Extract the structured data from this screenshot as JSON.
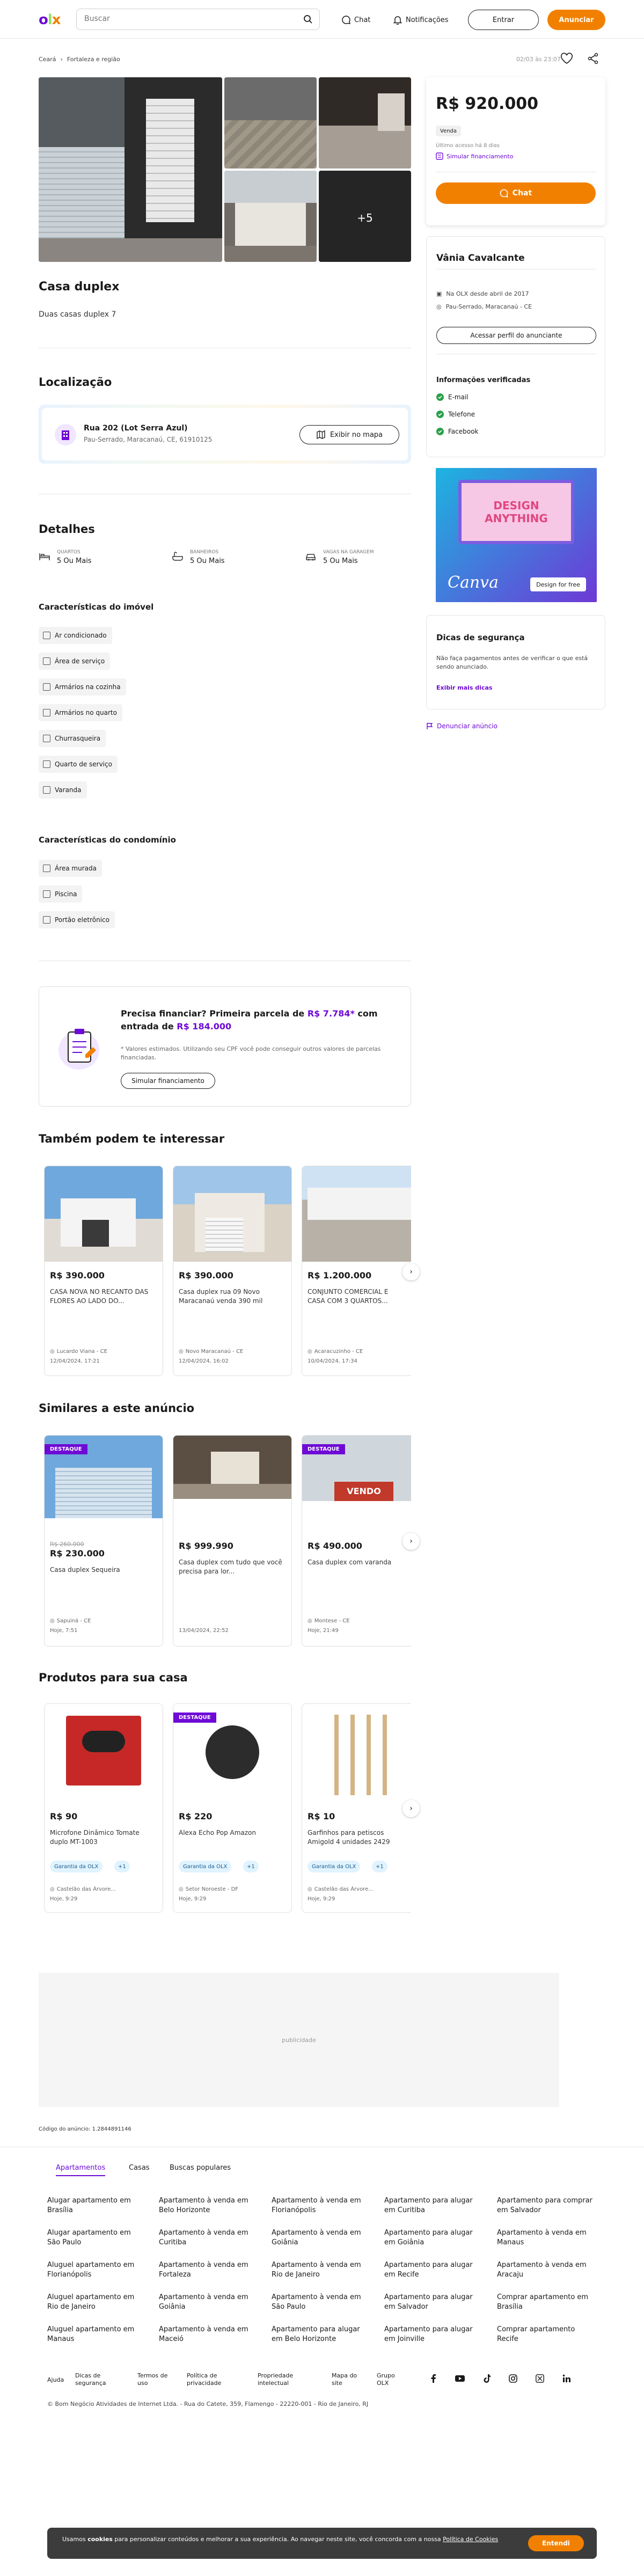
{
  "header": {
    "logo": {
      "o": "o",
      "l": "l",
      "x": "x"
    },
    "search_placeholder": "Buscar",
    "chat_label": "Chat",
    "notifications_label": "Notificações",
    "login_label": "Entrar",
    "advertise_label": "Anunciar"
  },
  "breadcrumb": {
    "items": [
      "Ceará",
      "Fortaleza e região"
    ],
    "date": "02/03 às 23:07"
  },
  "gallery": {
    "more_label": "+5"
  },
  "listing": {
    "title": "Casa duplex",
    "description": "Duas casas duplex 7",
    "location_heading": "Localização",
    "address_line1": "Rua 202 (Lot Serra Azul)",
    "address_line2": "Pau-Serrado, Maracanaú, CE, 61910125",
    "show_map_label": "Exibir no mapa",
    "details_heading": "Detalhes",
    "details": [
      {
        "label": "QUARTOS",
        "value": "5 Ou Mais"
      },
      {
        "label": "BANHEIROS",
        "value": "5 Ou Mais"
      },
      {
        "label": "VAGAS NA GARAGEM",
        "value": "5 Ou Mais"
      }
    ],
    "features_heading": "Características do imóvel",
    "features": [
      "Ar condicionado",
      "Área de serviço",
      "Armários na cozinha",
      "Armários no quarto",
      "Churrasqueira",
      "Quarto de serviço",
      "Varanda"
    ],
    "condo_heading": "Características do condomínio",
    "condo_features": [
      "Área murada",
      "Piscina",
      "Portão eletrônico"
    ]
  },
  "financing": {
    "title_prefix": "Precisa financiar? Primeira parcela de ",
    "first_installment": "R$ 7.784*",
    "title_mid": " com entrada de ",
    "down_payment": "R$ 184.000",
    "note": "* Valores estimados. Utilizando seu CPF você pode conseguir outros valores de parcelas financiadas.",
    "button": "Simular financiamento"
  },
  "interest": {
    "heading": "Também podem te interessar",
    "items": [
      {
        "price": "R$ 390.000",
        "title": "CASA NOVA NO RECANTO DAS FLORES AO LADO DO...",
        "location": "Lucardo Viana - CE",
        "date": "12/04/2024, 17:21"
      },
      {
        "price": "R$ 390.000",
        "title": "Casa duplex rua 09 Novo Maracanaú venda 390 mil",
        "location": "Novo Maracanaú - CE",
        "date": "12/04/2024, 16:02"
      },
      {
        "price": "R$ 1.200.000",
        "title": "CONJUNTO COMERCIAL E CASA COM 3 QUARTOS...",
        "location": "Acaracuzinho - CE",
        "date": "10/04/2024, 17:34"
      }
    ]
  },
  "similar": {
    "heading": "Similares a este anúncio",
    "badge": "DESTAQUE",
    "items": [
      {
        "old_price": "R$ 260.000",
        "price": "R$ 230.000",
        "title": "Casa duplex Sequeira",
        "location": "Sapuiná - CE",
        "date": "Hoje, 7:51"
      },
      {
        "old_price": "",
        "price": "R$ 999.990",
        "title": "Casa duplex com tudo que você precisa para lor...",
        "location": "",
        "date": "13/04/2024, 22:52"
      },
      {
        "old_price": "",
        "price": "R$ 490.000",
        "title": "Casa duplex com varanda",
        "location": "Montese - CE",
        "date": "Hoje, 21:49"
      }
    ],
    "sign_text": "VENDO"
  },
  "products": {
    "heading": "Produtos para sua casa",
    "badge": "DESTAQUE",
    "guarantee": "Garantia da OLX",
    "plus": "+1",
    "items": [
      {
        "price": "R$ 90",
        "title": "Microfone Dinâmico Tomate duplo MT-1003",
        "location": "Castelão das Árvore...",
        "date": "Hoje, 9:29"
      },
      {
        "price": "R$ 220",
        "title": "Alexa Echo Pop Amazon",
        "location": "Setor Noroeste - DF",
        "date": "Hoje, 9:29"
      },
      {
        "price": "R$ 10",
        "title": "Garfinhos para petiscos Amigold 4 unidades 2429",
        "location": "Castelão das Árvore...",
        "date": "Hoje, 9:29"
      }
    ]
  },
  "ad_placeholder": "publicidade",
  "ad_code": "Código do anúncio: 1.2844891146",
  "sidebar": {
    "price": "R$ 920.000",
    "sale_badge": "Venda",
    "last_access": "Último acesso há 8 dias",
    "simulate_label": "Simular financiamento",
    "chat_label": "Chat",
    "seller_name": "Vânia Cavalcante",
    "seller_since": "Na OLX desde abril de 2017",
    "seller_location": "Pau-Serrado, Maracanaú - CE",
    "profile_button": "Acessar perfil do anunciante",
    "verified_heading": "Informações verificadas",
    "verified": [
      "E-mail",
      "Telefone",
      "Facebook"
    ],
    "ad_title": "DESIGN ANYTHING",
    "ad_brand": "Canva",
    "ad_cta": "Design for free",
    "safety_heading": "Dicas de segurança",
    "safety_text": "Não faça pagamentos antes de verificar o que está sendo anunciado.",
    "safety_more": "Exibir mais dicas",
    "report_label": "Denunciar anúncio"
  },
  "footer": {
    "tabs": [
      "Apartamentos",
      "Casas",
      "Buscas populares"
    ],
    "links": [
      [
        "Alugar apartamento em Brasília",
        "Apartamento à venda em Belo Horizonte",
        "Apartamento à venda em Florianópolis",
        "Apartamento para alugar em Curitiba",
        "Apartamento para comprar em Salvador"
      ],
      [
        "Alugar apartamento em São Paulo",
        "Apartamento à venda em Curitiba",
        "Apartamento à venda em Goiânia",
        "Apartamento para alugar em Goiânia",
        "Apartamento à venda em Manaus"
      ],
      [
        "Aluguel apartamento em Florianópolis",
        "Apartamento à venda em Fortaleza",
        "Apartamento à venda em Rio de Janeiro",
        "Apartamento para alugar em Recife",
        "Apartamento à venda em Aracaju"
      ],
      [
        "Aluguel apartamento em Rio de Janeiro",
        "Apartamento à venda em Goiânia",
        "Apartamento à venda em São Paulo",
        "Apartamento para alugar em Salvador",
        "Comprar apartamento em Brasília"
      ],
      [
        "Aluguel apartamento em Manaus",
        "Apartamento à venda em Maceió",
        "Apartamento para alugar em Belo Horizonte",
        "Apartamento para alugar em Joinville",
        "Comprar apartamento Recife"
      ]
    ],
    "bottom_links": [
      "Ajuda",
      "Dicas de segurança",
      "Termos de uso",
      "Política de privacidade",
      "Propriedade intelectual",
      "Mapa do site",
      "Grupo OLX"
    ],
    "copyright": "© Bom Negócio Atividades de Internet Ltda. - Rua do Catete, 359, Flamengo - 22220-001 - Rio de Janeiro, RJ"
  },
  "cookie": {
    "text_prefix": "Usamos ",
    "text_bold": "cookies",
    "text_mid": " para personalizar conteúdos e melhorar a sua experiência. Ao navegar neste site, você concorda com a nossa ",
    "policy_link": "Política de Cookies",
    "button": "Entendi"
  },
  "colors": {
    "brand_purple": "#6e0ad6",
    "brand_orange": "#f28000",
    "brand_green": "#8ce563"
  }
}
